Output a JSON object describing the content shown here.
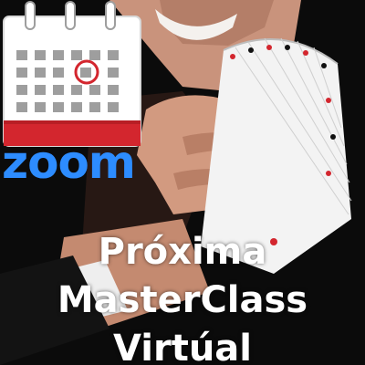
{
  "logo": {
    "text": "zoom",
    "color": "#2D8CFF"
  },
  "headline": {
    "line1": "Próxima",
    "line2": "MasterClass",
    "line3": "Virtúal"
  },
  "icons": [
    "calendar-icon",
    "zoom-logo"
  ],
  "colors": {
    "calendar_red": "#D3262E",
    "background": "#0b0b0b",
    "text": "#ffffff"
  }
}
